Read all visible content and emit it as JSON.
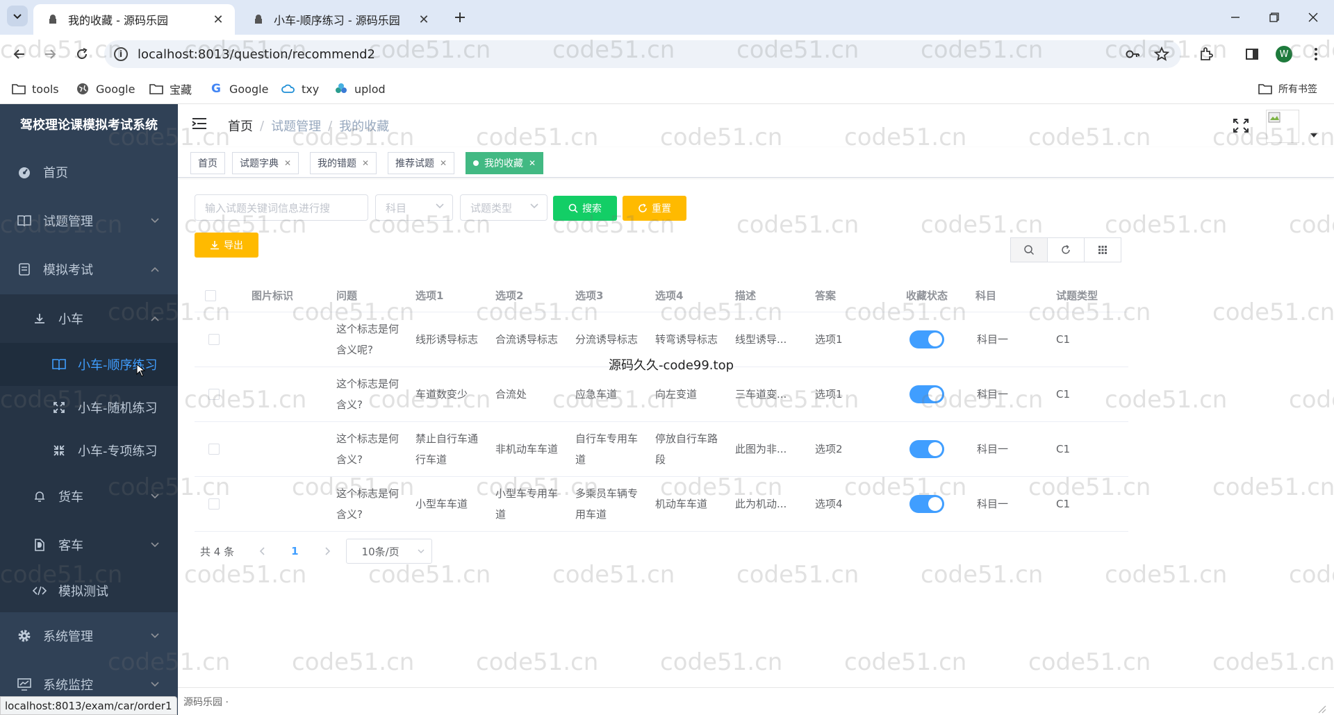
{
  "browser": {
    "tabs": [
      {
        "title": "我的收藏 - 源码乐园",
        "active": true
      },
      {
        "title": "小车-顺序练习 - 源码乐园",
        "active": false
      }
    ],
    "url": "localhost:8013/question/recommend2",
    "bookmarks": [
      "tools",
      "Google",
      "宝藏",
      "Google",
      "txy",
      "uplod"
    ],
    "all_bookmarks": "所有书签",
    "profile_initial": "W"
  },
  "sidebar": {
    "title": "驾校理论课模拟考试系统",
    "items": [
      {
        "label": "首页"
      },
      {
        "label": "试题管理"
      },
      {
        "label": "模拟考试"
      },
      {
        "label": "小车"
      },
      {
        "label": "小车-顺序练习"
      },
      {
        "label": "小车-随机练习"
      },
      {
        "label": "小车-专项练习"
      },
      {
        "label": "货车"
      },
      {
        "label": "客车"
      },
      {
        "label": "模拟测试"
      },
      {
        "label": "系统管理"
      },
      {
        "label": "系统监控"
      }
    ]
  },
  "breadcrumb": [
    "首页",
    "试题管理",
    "我的收藏"
  ],
  "tags": [
    "首页",
    "试题字典",
    "我的错题",
    "推荐试题",
    "我的收藏"
  ],
  "search": {
    "placeholder": "输入试题关键词信息进行搜",
    "subject_placeholder": "科目",
    "type_placeholder": "试题类型",
    "search_label": "搜索",
    "reset_label": "重置",
    "export_label": "导出"
  },
  "table": {
    "headers": [
      "图片标识",
      "问题",
      "选项1",
      "选项2",
      "选项3",
      "选项4",
      "描述",
      "答案",
      "收藏状态",
      "科目",
      "试题类型"
    ],
    "rows": [
      {
        "question": "这个标志是何含义呢?",
        "opt1": "线形诱导标志",
        "opt2": "合流诱导标志",
        "opt3": "分流诱导标志",
        "opt4": "转弯诱导标志",
        "desc": "线型诱导...",
        "answer": "选项1",
        "subject": "科目一",
        "type": "C1",
        "collected": true
      },
      {
        "question": "这个标志是何含义?",
        "opt1": "车道数变少",
        "opt2": "合流处",
        "opt3": "应急车道",
        "opt4": "向左变道",
        "desc": "三车道变...",
        "answer": "选项1",
        "subject": "科目一",
        "type": "C1",
        "collected": true
      },
      {
        "question": "这个标志是何含义?",
        "opt1": "禁止自行车通行车道",
        "opt2": "非机动车车道",
        "opt3": "自行车专用车道",
        "opt4": "停放自行车路段",
        "desc": "此图为非...",
        "answer": "选项2",
        "subject": "科目一",
        "type": "C1",
        "collected": true
      },
      {
        "question": "这个标志是何含义?",
        "opt1": "小型车车道",
        "opt2": "小型车专用车道",
        "opt3": "多乘员车辆专用车道",
        "opt4": "机动车车道",
        "desc": "此为机动...",
        "answer": "选项4",
        "subject": "科目一",
        "type": "C1",
        "collected": true
      }
    ]
  },
  "pagination": {
    "total": "共 4 条",
    "page": "1",
    "size": "10条/页"
  },
  "overlay": "源码久久-code99.top",
  "watermark": "code51.cn",
  "footer": "源码乐园 ·",
  "status_url": "localhost:8013/exam/car/order1",
  "colors": {
    "sidebar": "#304156",
    "accent": "#409eff",
    "tag_active": "#42b983",
    "search_btn": "#13ce66",
    "warn_btn": "#ffba00"
  }
}
